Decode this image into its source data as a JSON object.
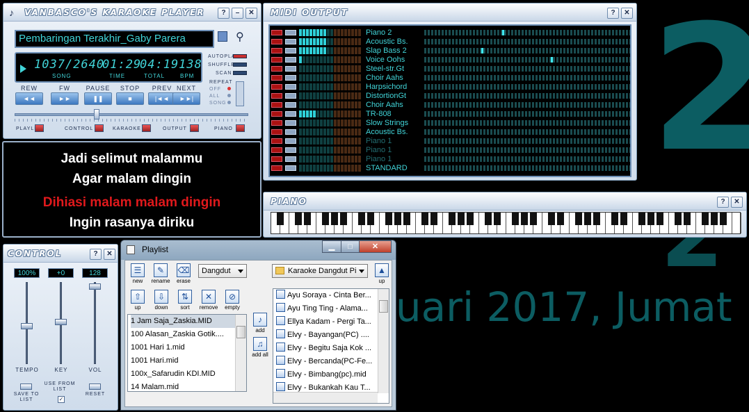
{
  "desktop": {
    "date_text": "ruari 2017, Jumat",
    "digit": "2",
    "digit2": "2"
  },
  "player": {
    "title": "VANBASCO'S KARAOKE PLAYER",
    "song": "Pembaringan Terakhir_Gaby Parera",
    "lcd": {
      "song": "1037/2640",
      "song_label": "SONG",
      "time": "01:29",
      "time_label": "TIME",
      "total": "04:19",
      "total_label": "TOTAL",
      "bpm": "138",
      "bpm_label": "BPM"
    },
    "options": {
      "autoplay": "AUTOPLAY",
      "shuffle": "SHUFFLE",
      "scan": "SCAN",
      "repeat": "REPEAT",
      "off": "OFF",
      "all": "ALL",
      "song": "SONG"
    },
    "transport": [
      {
        "label": "REW",
        "glyph": "◄◄"
      },
      {
        "label": "FW",
        "glyph": "►►"
      },
      {
        "label": "PAUSE",
        "glyph": "❚❚"
      },
      {
        "label": "STOP",
        "glyph": "■"
      },
      {
        "label": "PREV",
        "glyph": "|◄◄"
      },
      {
        "label": "NEXT",
        "glyph": "►►|"
      }
    ],
    "footer": {
      "playlist": "PLAYLIST",
      "control": "CONTROL",
      "karaoke": "KARAOKE",
      "output": "OUTPUT",
      "piano": "PIANO"
    },
    "help": "?",
    "minimize": "–",
    "close": "✕"
  },
  "lyrics": {
    "line1": "Jadi selimut malammu",
    "line2": "Agar malam dingin",
    "line3": "Dihiasi malam malam dingin",
    "line4": "Ingin rasanya diriku"
  },
  "midi": {
    "title": "MIDI OUTPUT",
    "channels": [
      {
        "name": "Piano 2",
        "level": 8,
        "active": true
      },
      {
        "name": "Acoustic Bs.",
        "level": 8,
        "active": true
      },
      {
        "name": "Slap Bass 2",
        "level": 8,
        "active": true
      },
      {
        "name": "Voice Oohs",
        "level": 1,
        "active": true
      },
      {
        "name": "Steel-str.Gt",
        "level": 0,
        "active": true
      },
      {
        "name": "Choir Aahs",
        "level": 0,
        "active": true
      },
      {
        "name": "Harpsichord",
        "level": 0,
        "active": true
      },
      {
        "name": "DistortionGt",
        "level": 0,
        "active": true
      },
      {
        "name": "Choir Aahs",
        "level": 0,
        "active": true
      },
      {
        "name": "TR-808",
        "level": 5,
        "active": true
      },
      {
        "name": "Slow Strings",
        "level": 0,
        "active": true
      },
      {
        "name": "Acoustic Bs.",
        "level": 0,
        "active": true
      },
      {
        "name": "Piano 1",
        "level": 0,
        "active": false
      },
      {
        "name": "Piano 1",
        "level": 0,
        "active": false
      },
      {
        "name": "Piano 1",
        "level": 0,
        "active": false
      },
      {
        "name": "STANDARD",
        "level": 0,
        "active": true
      }
    ]
  },
  "piano": {
    "title": "PIANO"
  },
  "control": {
    "title": "CONTROL",
    "tempo": "100%",
    "key": "+0",
    "vol": "128",
    "tempo_label": "TEMPO",
    "key_label": "KEY",
    "vol_label": "VOL",
    "save_to_list": "SAVE TO LIST",
    "use_from_list": "USE FROM LIST",
    "reset": "RESET"
  },
  "playlist": {
    "title": "Playlist",
    "tools_top": [
      "new",
      "rename",
      "erase"
    ],
    "tools_bottom": [
      "up",
      "down",
      "sort",
      "remove",
      "empty"
    ],
    "category": "Dangdut",
    "folder": "Karaoke Dangdut Pi",
    "up_label": "up",
    "add": "add",
    "add_all": "add all",
    "items": [
      "1 Jam Saja_Zaskia.MID",
      "100 Alasan_Zaskia Gotik....",
      "1001 Hari 1.mid",
      "1001 Hari.mid",
      "100x_Safarudin KDI.MID",
      "14 Malam.mid"
    ],
    "folder_items": [
      "Ayu Soraya - Cinta Ber...",
      "Ayu Ting Ting - Alama...",
      "Ellya Kadam - Pergi Ta...",
      "Elvy - Bayangan(PC) ....",
      "Elvy - Begitu Saja Kok ...",
      "Elvy - Bercanda(PC-Fe...",
      "Elvy - Bimbang(pc).mid",
      "Elvy - Bukankah Kau T..."
    ]
  }
}
